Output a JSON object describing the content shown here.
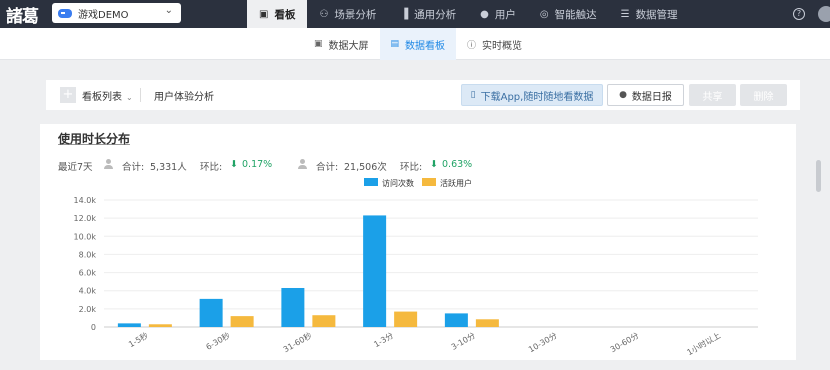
{
  "topnav": {
    "logo": "諸葛",
    "app_select": "游戏DEMO",
    "items": [
      {
        "label": "看板",
        "icon": "dashboard-icon",
        "glyph": "▣"
      },
      {
        "label": "场景分析",
        "icon": "flow-icon",
        "glyph": "⚇"
      },
      {
        "label": "通用分析",
        "icon": "bar-chart-icon",
        "glyph": "▐"
      },
      {
        "label": "用户",
        "icon": "user-icon",
        "glyph": "●"
      },
      {
        "label": "智能触达",
        "icon": "target-icon",
        "glyph": "◎"
      },
      {
        "label": "数据管理",
        "icon": "database-icon",
        "glyph": "☰"
      }
    ],
    "help_glyph": "?"
  },
  "subnav": {
    "items": [
      {
        "label": "数据大屏",
        "icon": "screen-icon",
        "glyph": "▣"
      },
      {
        "label": "数据看板",
        "icon": "board-icon",
        "glyph": "▤"
      },
      {
        "label": "实时概览",
        "icon": "info-icon",
        "glyph": "ⓘ"
      }
    ]
  },
  "toolbar": {
    "add_glyph": "+",
    "list_label": "看板列表",
    "board_title": "用户体验分析",
    "download_label": "下载App,随时随地看数据",
    "report_label": "数据日报",
    "share_label": "共享",
    "delete_label": "删除"
  },
  "panel": {
    "title": "使用时长分布",
    "period": "最近7天",
    "stat1_label": "合计:",
    "stat1_value": "5,331人",
    "stat1_ratio_label": "环比:",
    "stat1_ratio": "0.17%",
    "stat2_label": "合计:",
    "stat2_value": "21,506次",
    "stat2_ratio_label": "环比:",
    "stat2_ratio": "0.63%",
    "arrow": "⬇"
  },
  "colors": {
    "visits": "#1ba0e8",
    "active": "#f5b93e"
  },
  "chart_data": {
    "type": "bar",
    "categories": [
      "1-5秒",
      "6-30秒",
      "31-60秒",
      "1-3分",
      "3-10分",
      "10-30分",
      "30-60分",
      "1小时以上"
    ],
    "series": [
      {
        "name": "访问次数",
        "values": [
          400,
          3100,
          4300,
          12300,
          1500,
          0,
          0,
          0
        ]
      },
      {
        "name": "活跃用户",
        "values": [
          300,
          1200,
          1300,
          1700,
          850,
          0,
          0,
          0
        ]
      }
    ],
    "yticks": [
      "0",
      "2.0k",
      "4.0k",
      "6.0k",
      "8.0k",
      "10.0k",
      "12.0k",
      "14.0k"
    ],
    "ylim": [
      0,
      14000
    ],
    "legend": "top-center",
    "grid": true
  }
}
